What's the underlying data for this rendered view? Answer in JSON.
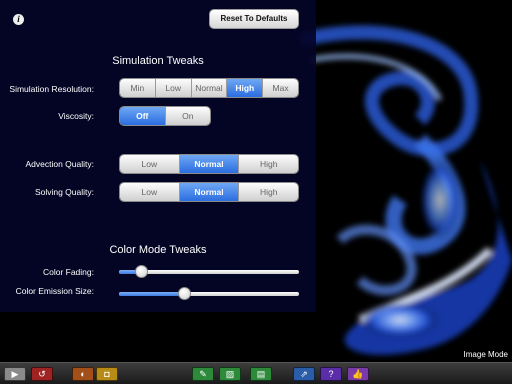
{
  "info_icon": "i",
  "reset_button": "Reset To Defaults",
  "simulation_tweaks": {
    "title": "Simulation Tweaks",
    "resolution": {
      "label": "Simulation Resolution:",
      "options": [
        "Min",
        "Low",
        "Normal",
        "High",
        "Max"
      ],
      "selected": "High"
    },
    "viscosity": {
      "label": "Viscosity:",
      "options": [
        "Off",
        "On"
      ],
      "selected": "Off"
    },
    "advection_quality": {
      "label": "Advection Quality:",
      "options": [
        "Low",
        "Normal",
        "High"
      ],
      "selected": "Normal"
    },
    "solving_quality": {
      "label": "Solving Quality:",
      "options": [
        "Low",
        "Normal",
        "High"
      ],
      "selected": "Normal"
    }
  },
  "color_mode_tweaks": {
    "title": "Color Mode Tweaks",
    "color_fading": {
      "label": "Color Fading:",
      "value_fraction": 0.12
    },
    "color_emission_size": {
      "label": "Color Emission Size:",
      "value_fraction": 0.36
    }
  },
  "mode_label": "Image Mode",
  "toolbar": {
    "buttons": [
      {
        "name": "play-icon",
        "color": "#8a8a8a"
      },
      {
        "name": "reset-icon",
        "color": "#a02323"
      },
      {
        "name": "color-contrast-icon",
        "color": "#a34f1a"
      },
      {
        "name": "camera-icon",
        "color": "#b88a16"
      },
      {
        "name": "image-brush-icon",
        "color": "#2c8a3a"
      },
      {
        "name": "image-icon",
        "color": "#2c8a3a"
      },
      {
        "name": "image-menu-icon",
        "color": "#2c8a3a"
      },
      {
        "name": "share-icon",
        "color": "#2a5ca8"
      },
      {
        "name": "help-icon",
        "color": "#5a2ea8"
      },
      {
        "name": "like-icon",
        "color": "#7a3aa8"
      }
    ]
  },
  "colors": {
    "panel": "#04042a",
    "accent": "#2a6de0"
  }
}
